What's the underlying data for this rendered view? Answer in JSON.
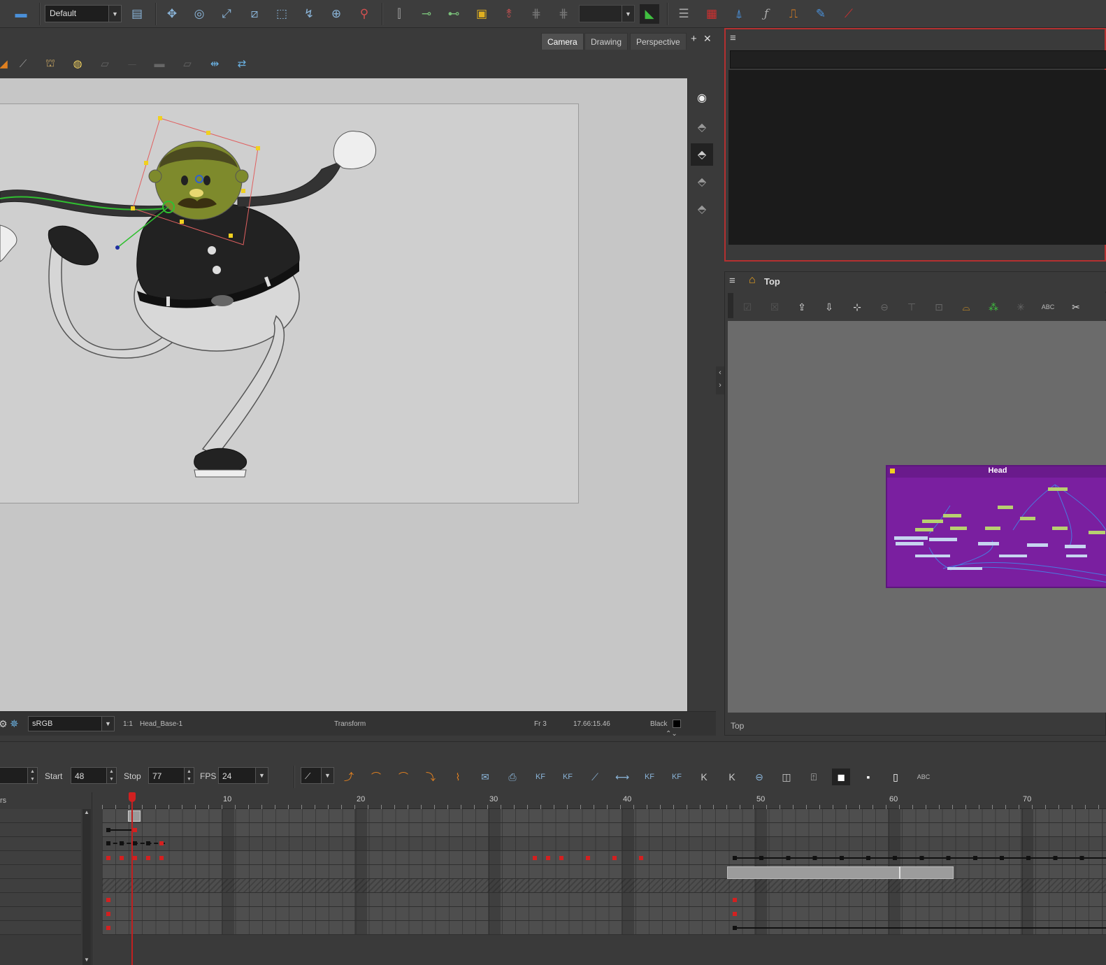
{
  "toolbar": {
    "workspace": "Default"
  },
  "view": {
    "tabs": [
      "Camera",
      "Drawing",
      "Perspective"
    ],
    "active_tab": "Camera",
    "status": {
      "colorspace": "sRGB",
      "zoom": "1:1",
      "layer": "Head_Base-1",
      "tool": "Transform",
      "frame": "Fr 3",
      "coords": "17.66:15.46",
      "bg_color_label": "Black"
    }
  },
  "node_view": {
    "breadcrumb": "Top",
    "footer": "Top",
    "group_name": "Head"
  },
  "timeline": {
    "start_label": "Start",
    "start_value": "48",
    "stop_label": "Stop",
    "stop_value": "77",
    "fps_label": "FPS",
    "fps_value": "24",
    "layers_header": "rs",
    "ruler": [
      "10",
      "20",
      "30",
      "40",
      "50",
      "60",
      "70"
    ],
    "current_frame": 3
  },
  "colors": {
    "accent_red": "#c02020",
    "node_group": "#7a1fa0",
    "stage_bg": "#c6c6c6"
  }
}
